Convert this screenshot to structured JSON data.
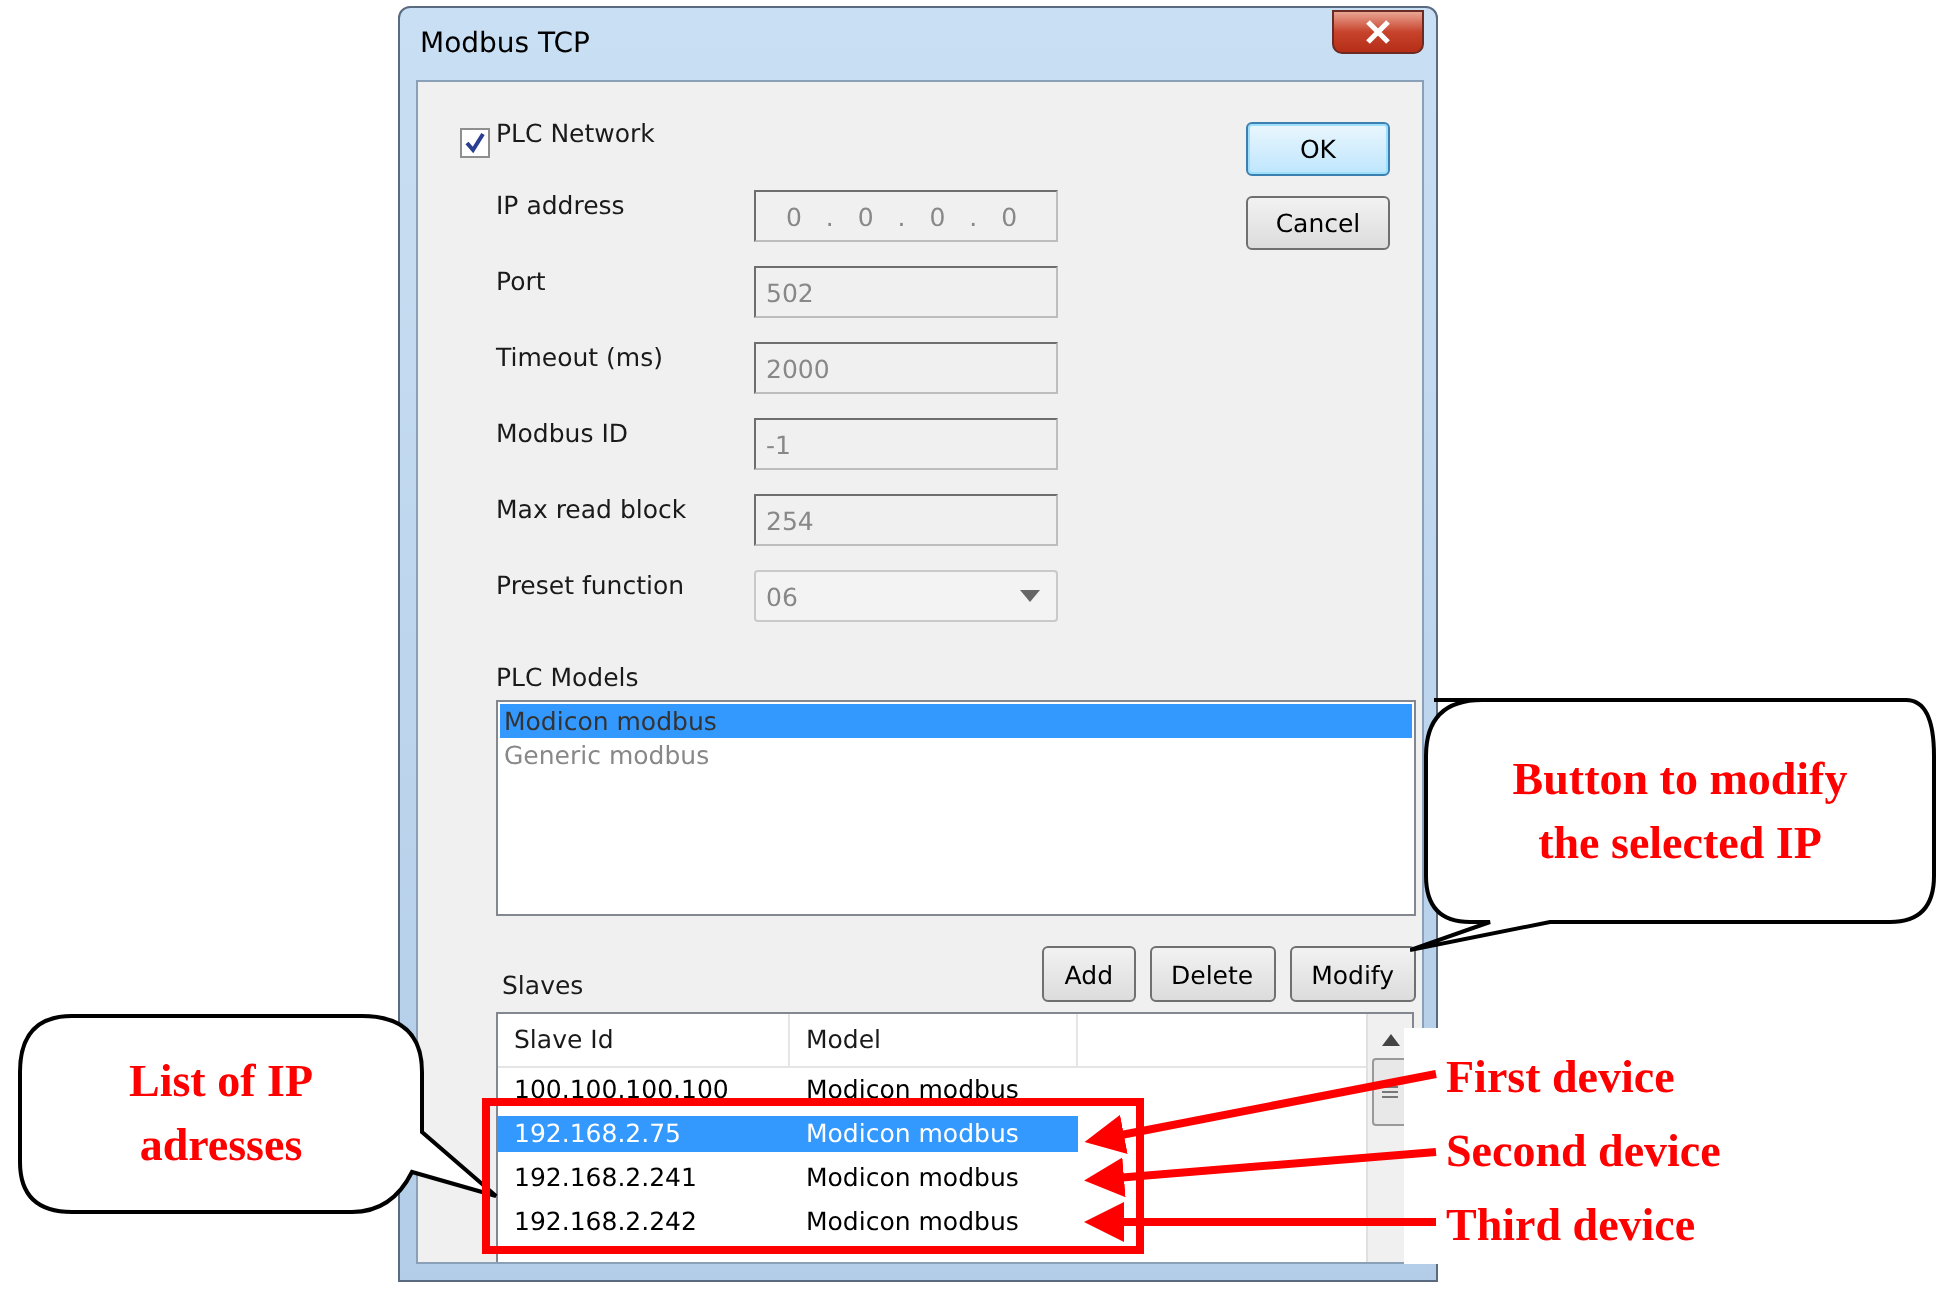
{
  "window": {
    "title": "Modbus TCP"
  },
  "plc_network": {
    "label": "PLC Network",
    "checked": true
  },
  "fields": [
    {
      "label": "IP address",
      "kind": "ip",
      "value": "0 . 0 . 0 . 0",
      "disabled": true
    },
    {
      "label": "Port",
      "kind": "text",
      "value": "502",
      "disabled": true
    },
    {
      "label": "Timeout (ms)",
      "kind": "text",
      "value": "2000",
      "disabled": true
    },
    {
      "label": "Modbus ID",
      "kind": "text",
      "value": "-1",
      "disabled": true
    },
    {
      "label": "Max read block",
      "kind": "text",
      "value": "254",
      "disabled": true
    },
    {
      "label": "Preset function",
      "kind": "dropdown",
      "value": "06",
      "disabled": true
    }
  ],
  "dialog_buttons": [
    {
      "label": "OK",
      "default": true
    },
    {
      "label": "Cancel",
      "default": false
    }
  ],
  "plc_models": {
    "label": "PLC Models",
    "items": [
      {
        "label": "Modicon modbus",
        "selected": true
      },
      {
        "label": "Generic modbus",
        "selected": false
      }
    ]
  },
  "slaves": {
    "label": "Slaves",
    "buttons": [
      "Add",
      "Delete",
      "Modify"
    ],
    "columns": [
      "Slave Id",
      "Model"
    ],
    "rows": [
      {
        "slave_id": "100.100.100.100",
        "model": "Modicon modbus",
        "selected": false
      },
      {
        "slave_id": "192.168.2.75",
        "model": "Modicon modbus",
        "selected": true
      },
      {
        "slave_id": "192.168.2.241",
        "model": "Modicon modbus",
        "selected": false
      },
      {
        "slave_id": "192.168.2.242",
        "model": "Modicon modbus",
        "selected": false
      }
    ]
  },
  "callouts": [
    {
      "text": "Button to modify\nthe selected IP"
    },
    {
      "text": "List of IP\nadresses"
    }
  ],
  "device_labels": [
    "First device",
    "Second device",
    "Third device"
  ]
}
